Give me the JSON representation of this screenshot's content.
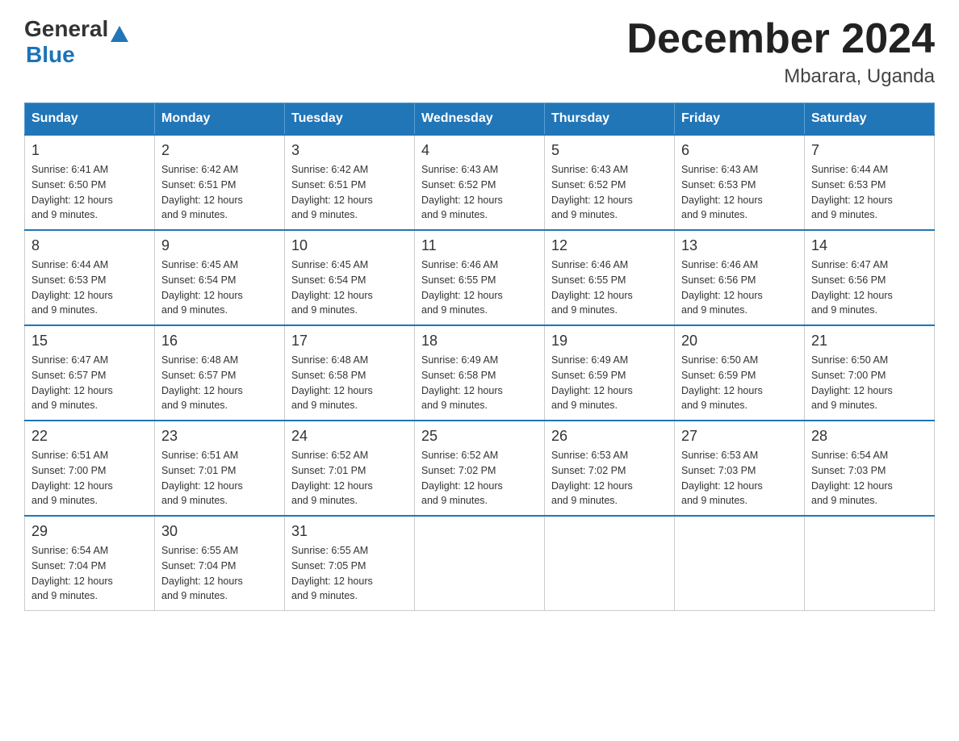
{
  "header": {
    "logo_general": "General",
    "logo_blue": "Blue",
    "title": "December 2024",
    "subtitle": "Mbarara, Uganda"
  },
  "days_of_week": [
    "Sunday",
    "Monday",
    "Tuesday",
    "Wednesday",
    "Thursday",
    "Friday",
    "Saturday"
  ],
  "weeks": [
    [
      {
        "day": "1",
        "sunrise": "6:41 AM",
        "sunset": "6:50 PM",
        "daylight": "12 hours and 9 minutes."
      },
      {
        "day": "2",
        "sunrise": "6:42 AM",
        "sunset": "6:51 PM",
        "daylight": "12 hours and 9 minutes."
      },
      {
        "day": "3",
        "sunrise": "6:42 AM",
        "sunset": "6:51 PM",
        "daylight": "12 hours and 9 minutes."
      },
      {
        "day": "4",
        "sunrise": "6:43 AM",
        "sunset": "6:52 PM",
        "daylight": "12 hours and 9 minutes."
      },
      {
        "day": "5",
        "sunrise": "6:43 AM",
        "sunset": "6:52 PM",
        "daylight": "12 hours and 9 minutes."
      },
      {
        "day": "6",
        "sunrise": "6:43 AM",
        "sunset": "6:53 PM",
        "daylight": "12 hours and 9 minutes."
      },
      {
        "day": "7",
        "sunrise": "6:44 AM",
        "sunset": "6:53 PM",
        "daylight": "12 hours and 9 minutes."
      }
    ],
    [
      {
        "day": "8",
        "sunrise": "6:44 AM",
        "sunset": "6:53 PM",
        "daylight": "12 hours and 9 minutes."
      },
      {
        "day": "9",
        "sunrise": "6:45 AM",
        "sunset": "6:54 PM",
        "daylight": "12 hours and 9 minutes."
      },
      {
        "day": "10",
        "sunrise": "6:45 AM",
        "sunset": "6:54 PM",
        "daylight": "12 hours and 9 minutes."
      },
      {
        "day": "11",
        "sunrise": "6:46 AM",
        "sunset": "6:55 PM",
        "daylight": "12 hours and 9 minutes."
      },
      {
        "day": "12",
        "sunrise": "6:46 AM",
        "sunset": "6:55 PM",
        "daylight": "12 hours and 9 minutes."
      },
      {
        "day": "13",
        "sunrise": "6:46 AM",
        "sunset": "6:56 PM",
        "daylight": "12 hours and 9 minutes."
      },
      {
        "day": "14",
        "sunrise": "6:47 AM",
        "sunset": "6:56 PM",
        "daylight": "12 hours and 9 minutes."
      }
    ],
    [
      {
        "day": "15",
        "sunrise": "6:47 AM",
        "sunset": "6:57 PM",
        "daylight": "12 hours and 9 minutes."
      },
      {
        "day": "16",
        "sunrise": "6:48 AM",
        "sunset": "6:57 PM",
        "daylight": "12 hours and 9 minutes."
      },
      {
        "day": "17",
        "sunrise": "6:48 AM",
        "sunset": "6:58 PM",
        "daylight": "12 hours and 9 minutes."
      },
      {
        "day": "18",
        "sunrise": "6:49 AM",
        "sunset": "6:58 PM",
        "daylight": "12 hours and 9 minutes."
      },
      {
        "day": "19",
        "sunrise": "6:49 AM",
        "sunset": "6:59 PM",
        "daylight": "12 hours and 9 minutes."
      },
      {
        "day": "20",
        "sunrise": "6:50 AM",
        "sunset": "6:59 PM",
        "daylight": "12 hours and 9 minutes."
      },
      {
        "day": "21",
        "sunrise": "6:50 AM",
        "sunset": "7:00 PM",
        "daylight": "12 hours and 9 minutes."
      }
    ],
    [
      {
        "day": "22",
        "sunrise": "6:51 AM",
        "sunset": "7:00 PM",
        "daylight": "12 hours and 9 minutes."
      },
      {
        "day": "23",
        "sunrise": "6:51 AM",
        "sunset": "7:01 PM",
        "daylight": "12 hours and 9 minutes."
      },
      {
        "day": "24",
        "sunrise": "6:52 AM",
        "sunset": "7:01 PM",
        "daylight": "12 hours and 9 minutes."
      },
      {
        "day": "25",
        "sunrise": "6:52 AM",
        "sunset": "7:02 PM",
        "daylight": "12 hours and 9 minutes."
      },
      {
        "day": "26",
        "sunrise": "6:53 AM",
        "sunset": "7:02 PM",
        "daylight": "12 hours and 9 minutes."
      },
      {
        "day": "27",
        "sunrise": "6:53 AM",
        "sunset": "7:03 PM",
        "daylight": "12 hours and 9 minutes."
      },
      {
        "day": "28",
        "sunrise": "6:54 AM",
        "sunset": "7:03 PM",
        "daylight": "12 hours and 9 minutes."
      }
    ],
    [
      {
        "day": "29",
        "sunrise": "6:54 AM",
        "sunset": "7:04 PM",
        "daylight": "12 hours and 9 minutes."
      },
      {
        "day": "30",
        "sunrise": "6:55 AM",
        "sunset": "7:04 PM",
        "daylight": "12 hours and 9 minutes."
      },
      {
        "day": "31",
        "sunrise": "6:55 AM",
        "sunset": "7:05 PM",
        "daylight": "12 hours and 9 minutes."
      },
      null,
      null,
      null,
      null
    ]
  ],
  "labels": {
    "sunrise": "Sunrise:",
    "sunset": "Sunset:",
    "daylight": "Daylight:"
  }
}
